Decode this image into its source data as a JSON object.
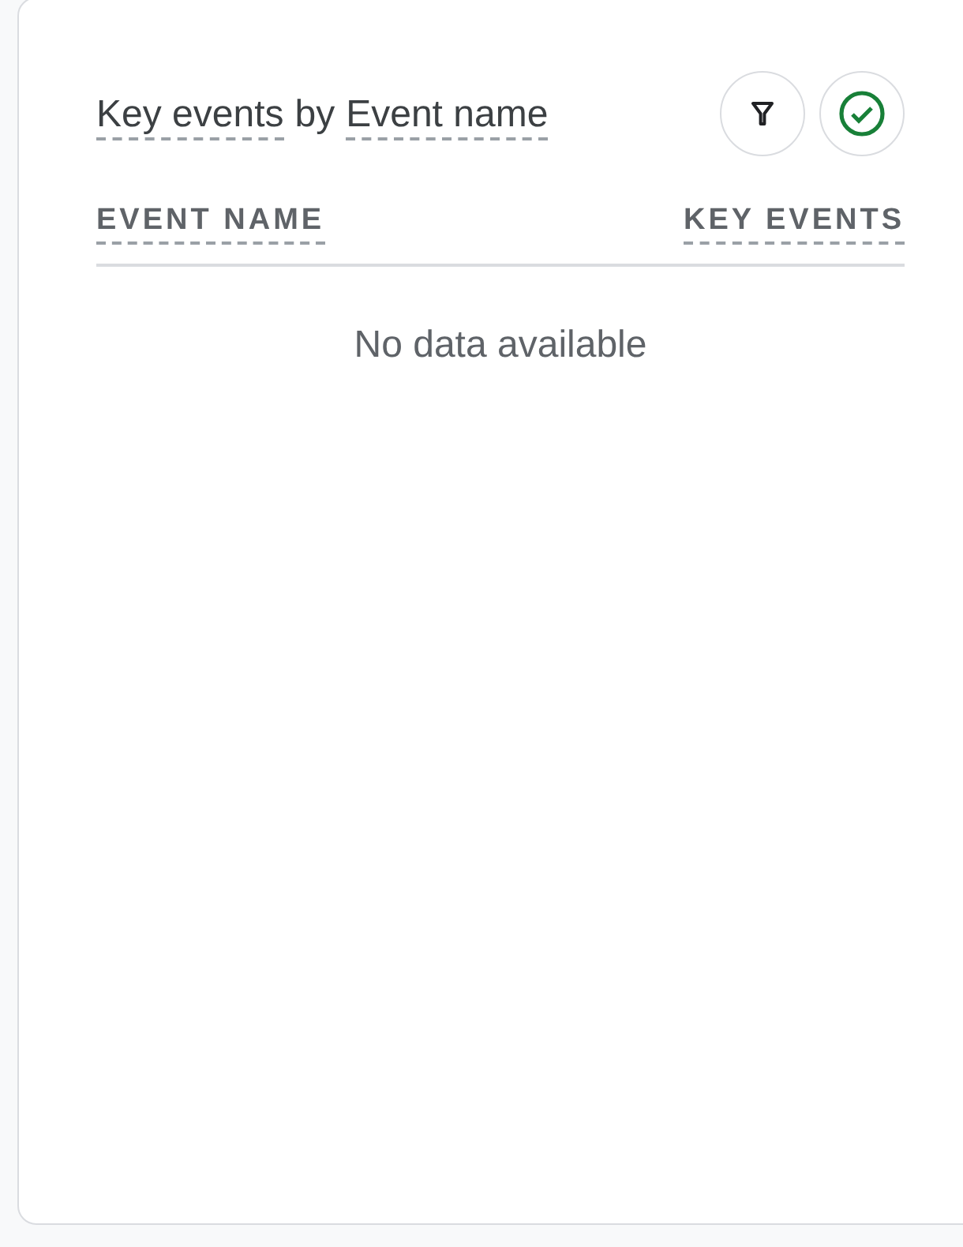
{
  "card": {
    "title": [
      {
        "text": "Key events",
        "kind": "metric"
      },
      {
        "text": "by",
        "kind": "plain"
      },
      {
        "text": "Event name",
        "kind": "metric"
      }
    ],
    "actions": [
      {
        "kind": "filter"
      },
      {
        "kind": "compare"
      }
    ],
    "table": {
      "columns": [
        {
          "label": "EVENT NAME"
        },
        {
          "label": "KEY EVENTS"
        }
      ],
      "empty_message": "No data available"
    }
  }
}
